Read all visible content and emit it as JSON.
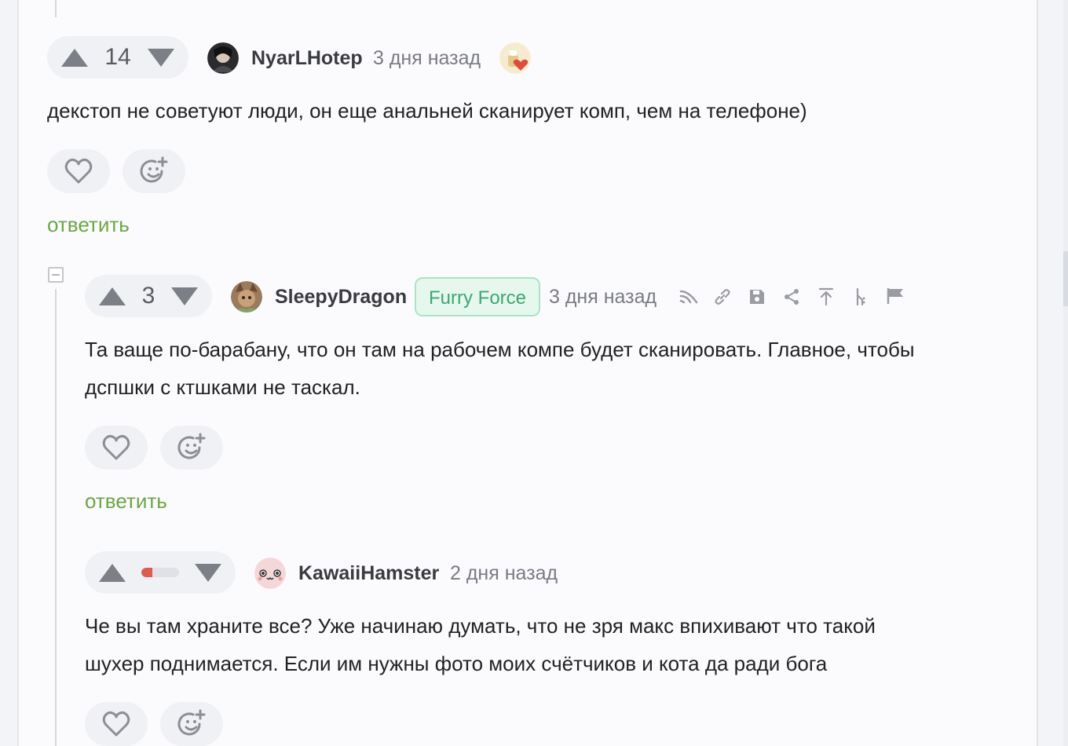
{
  "comments": [
    {
      "rating": "14",
      "username": "NyarLHotep",
      "time": "3 дня назад",
      "text": "декстоп не советуют люди, он еще анальней сканирует комп, чем на телефоне)",
      "reply_label": "ответить"
    },
    {
      "rating": "3",
      "username": "SleepyDragon",
      "community_badge": "Furry Force",
      "time": "3 дня назад",
      "text": "Та ваще по-барабану, что он там на рабочем компе будет сканировать. Главное, чтобы\nдспшки с ктшками не таскал.",
      "reply_label": "ответить"
    },
    {
      "rating_bar_fraction": 0.3,
      "username": "KawaiiHamster",
      "time": "2 дня назад",
      "text": "Че вы там храните все? Уже начинаю думать, что не зря макс впихивают что такой\nшухер поднимается. Если им нужны фото моих счётчиков и кота да ради бога"
    }
  ],
  "colors": {
    "accent_green": "#6aa841",
    "badge_green": "#3aa874",
    "negative_red": "#e05a4f"
  },
  "icons": {
    "vote_up": "arrow-up-icon",
    "vote_down": "arrow-down-icon",
    "like": "heart-icon",
    "reaction": "emoji-add-icon",
    "toolbar": [
      "branch-icon",
      "link-icon",
      "save-icon",
      "share-icon",
      "scroll-top-icon",
      "tree-icon",
      "flag-icon"
    ]
  }
}
